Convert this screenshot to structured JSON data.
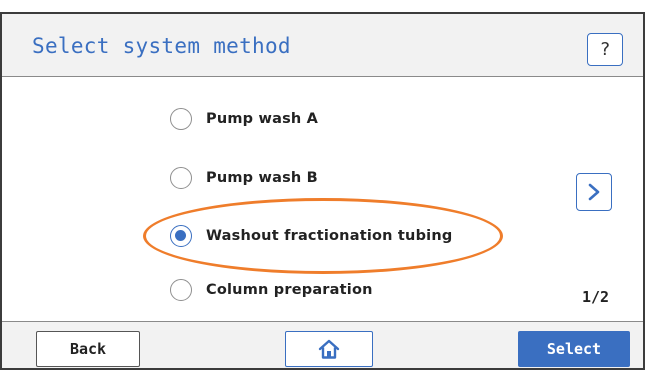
{
  "header": {
    "title": "Select system method",
    "help_label": "?"
  },
  "methods": [
    {
      "label": "Pump wash A",
      "selected": false
    },
    {
      "label": "Pump wash B",
      "selected": false
    },
    {
      "label": "Washout fractionation tubing",
      "selected": true
    },
    {
      "label": "Column preparation",
      "selected": false
    }
  ],
  "pagination": {
    "indicator": "1/2",
    "next_icon": "chevron-right-icon"
  },
  "footer": {
    "back_label": "Back",
    "home_icon": "home-icon",
    "select_label": "Select"
  },
  "colors": {
    "accent": "#3a6fc1",
    "highlight": "#ef7d2b",
    "bar_background": "#f2f2f2"
  }
}
